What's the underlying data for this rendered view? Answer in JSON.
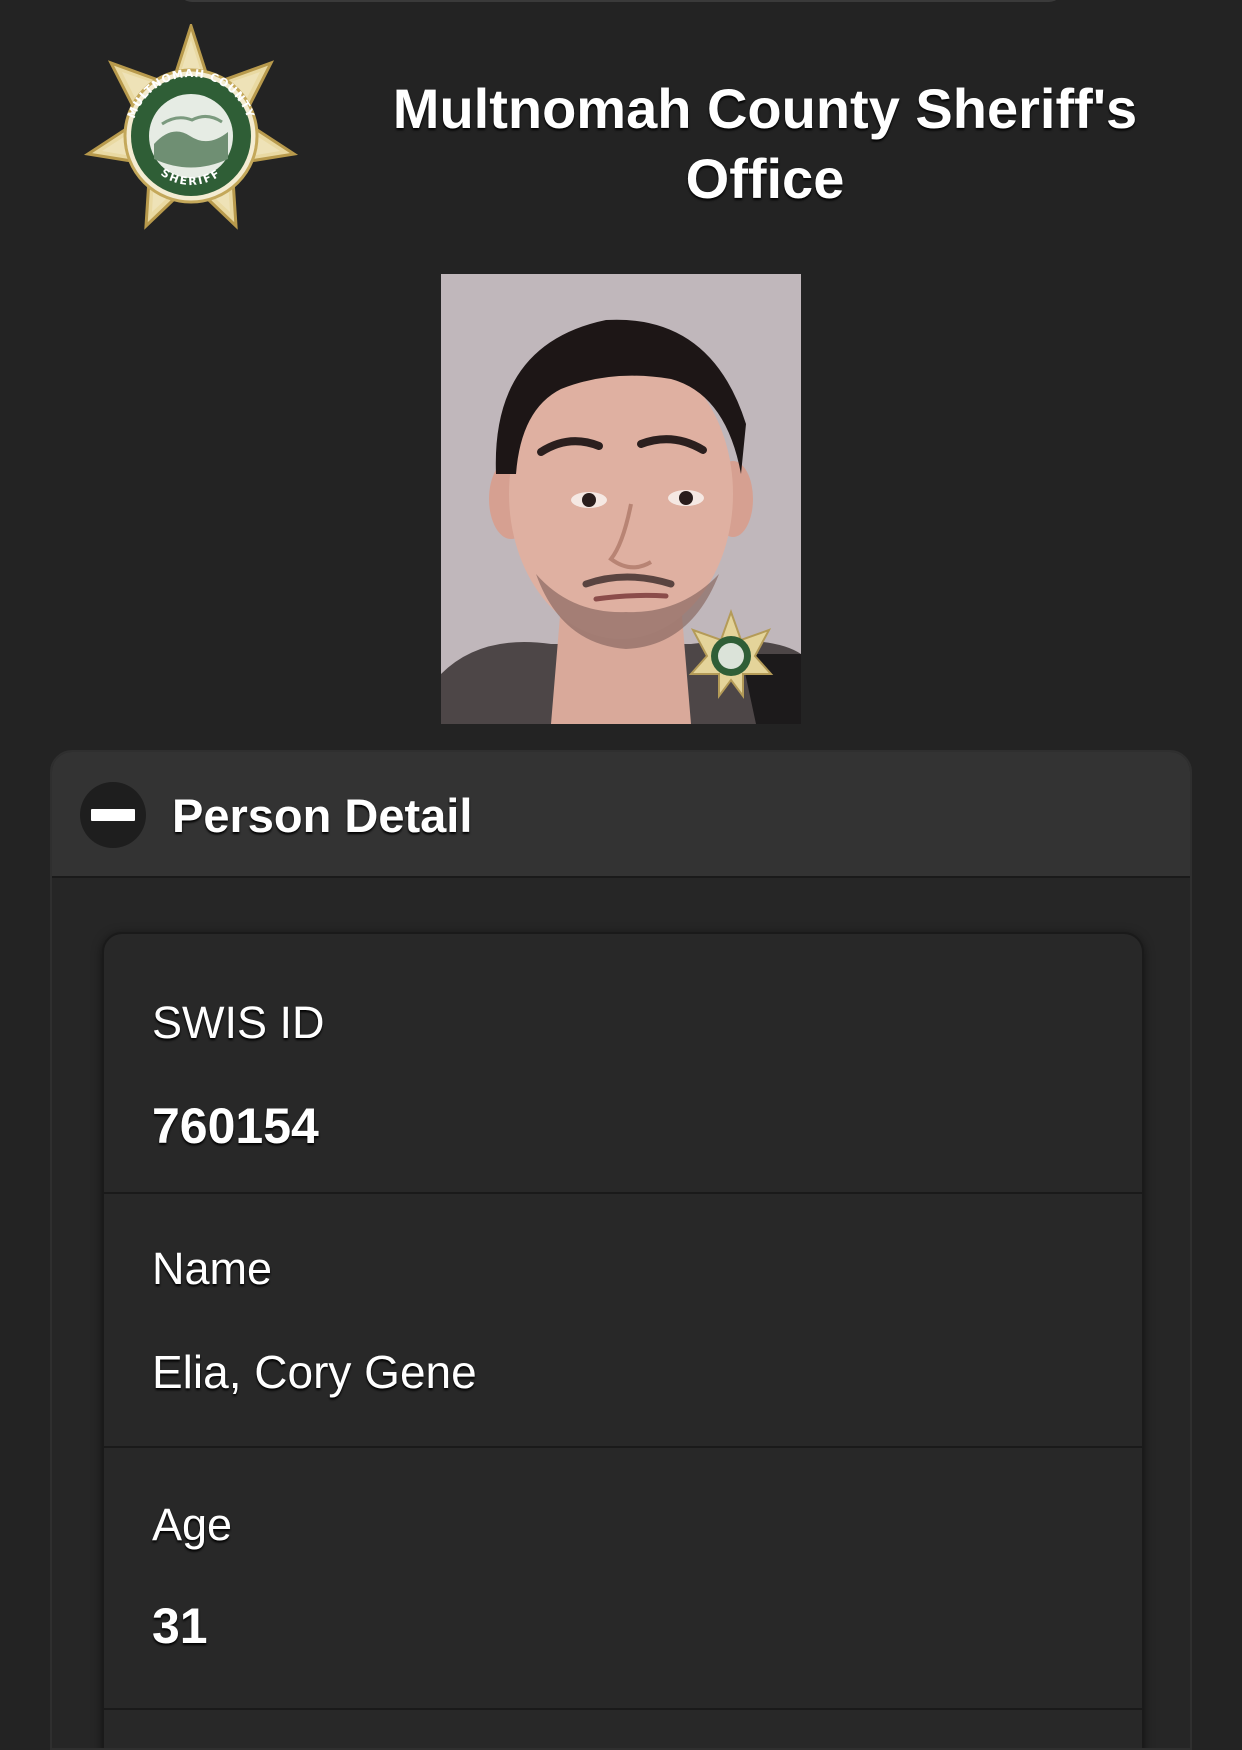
{
  "header": {
    "org_title": "Multnomah County Sheriff's Office",
    "badge_text_top": "MULTNOMAH COUNTY",
    "badge_text_bottom": "SHERIFF"
  },
  "booking_photo": {
    "description": "booking photo"
  },
  "panel": {
    "title": "Person Detail",
    "collapse_icon": "minus-icon",
    "fields": [
      {
        "label": "SWIS ID",
        "value": "760154"
      },
      {
        "label": "Name",
        "value": "Elia, Cory Gene"
      },
      {
        "label": "Age",
        "value": "31"
      }
    ]
  },
  "colors": {
    "background": "#232323",
    "panel_header": "#333333",
    "card": "#282828",
    "badge_gold": "#d9c27a",
    "badge_green": "#2f5e36",
    "text": "#ffffff"
  }
}
